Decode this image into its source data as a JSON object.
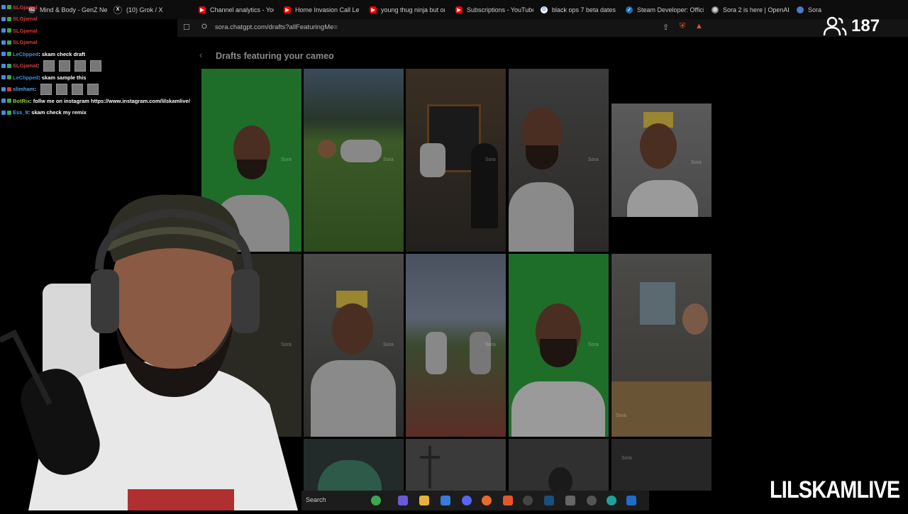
{
  "tabs": [
    {
      "label": "Mind & Body - GenZ Ne",
      "icon": "gz-icon",
      "color": "#555555"
    },
    {
      "label": "(10) Grok / X",
      "icon": "x-icon",
      "color": "#000000"
    },
    {
      "label": "Channel analytics - YouT",
      "icon": "youtube-icon",
      "color": "#ff0000"
    },
    {
      "label": "Home Invasion Call Lead",
      "icon": "youtube-icon",
      "color": "#ff0000"
    },
    {
      "label": "young thug ninja but on",
      "icon": "youtube-icon",
      "color": "#ff0000"
    },
    {
      "label": "Subscriptions - YouTube",
      "icon": "youtube-icon",
      "color": "#ff0000"
    },
    {
      "label": "black ops 7 beta dates",
      "icon": "google-icon",
      "color": "#ffffff"
    },
    {
      "label": "Steam Developer: Officia",
      "icon": "steam-icon",
      "color": "#1b6fb5"
    },
    {
      "label": "Sora 2 is here | OpenAI",
      "icon": "openai-icon",
      "color": "#888888"
    },
    {
      "label": "Sora",
      "icon": "sora-icon",
      "color": "#4a7ac8"
    }
  ],
  "address_bar": {
    "url": "sora.chatgpt.com/drafts?allFeaturingMe="
  },
  "page": {
    "back_symbol": "‹",
    "title": "Drafts featuring your cameo",
    "watermark": "Sora"
  },
  "chat": [
    {
      "user": "SLGjamal",
      "text": "",
      "user_color": "#d23b3b"
    },
    {
      "user": "SLGjamal",
      "text": "",
      "user_color": "#d23b3b"
    },
    {
      "user": "SLGjamal",
      "text": "",
      "user_color": "#d23b3b"
    },
    {
      "user": "SLGjamal",
      "text": "",
      "user_color": "#d23b3b"
    },
    {
      "user": "LeClipped",
      "text": ": skam check draft",
      "user_color": "#3b8fe0"
    },
    {
      "user": "SLGjamal",
      "text": ":",
      "user_color": "#d23b3b",
      "emotes": 4
    },
    {
      "user": "LeClipped",
      "text": ": skam sample this",
      "user_color": "#3b8fe0"
    },
    {
      "user": "slimham",
      "text": ":",
      "user_color": "#4aa3df",
      "emotes": 4
    },
    {
      "user": "BotRix",
      "text": ": follw me on instagram https://www.instagram.com/lilskamlive/",
      "user_color": "#9acd32"
    },
    {
      "user": "Ess_9",
      "text": ": skam check my remix",
      "user_color": "#4aa3df"
    }
  ],
  "viewers": {
    "count": "187",
    "icon": "viewers-icon"
  },
  "taskbar": {
    "search_label": "Search"
  },
  "branding": {
    "name": "LILSKAMLIVE"
  }
}
